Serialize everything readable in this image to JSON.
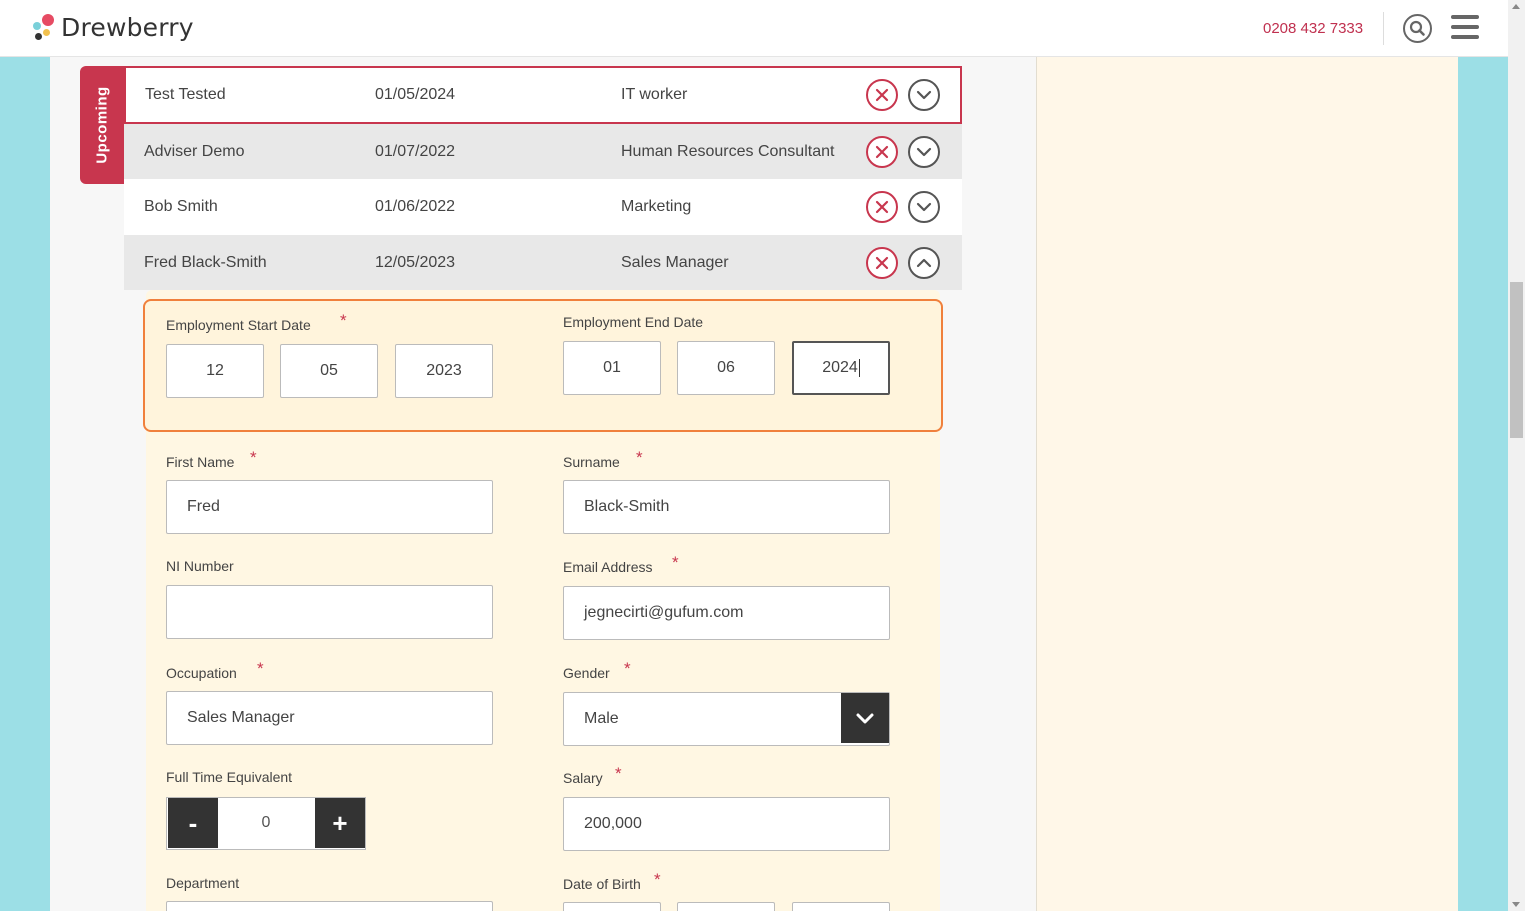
{
  "header": {
    "brand": "Drewberry",
    "phone": "0208 432 7333"
  },
  "upcoming_tab": "Upcoming",
  "employees": [
    {
      "name": "Test Tested",
      "date": "01/05/2024",
      "role": "IT worker"
    },
    {
      "name": "Adviser Demo",
      "date": "01/07/2022",
      "role": "Human Resources Consultant"
    },
    {
      "name": "Bob Smith",
      "date": "01/06/2022",
      "role": "Marketing"
    },
    {
      "name": "Fred Black-Smith",
      "date": "12/05/2023",
      "role": "Sales Manager"
    }
  ],
  "form": {
    "start_date": {
      "label": "Employment Start Date",
      "day": "12",
      "month": "05",
      "year": "2023"
    },
    "end_date": {
      "label": "Employment End Date",
      "day": "01",
      "month": "06",
      "year": "2024"
    },
    "first_name": {
      "label": "First Name",
      "value": "Fred"
    },
    "surname": {
      "label": "Surname",
      "value": "Black-Smith"
    },
    "ni_number": {
      "label": "NI Number",
      "value": ""
    },
    "email": {
      "label": "Email Address",
      "value": "jegnecirti@gufum.com"
    },
    "occupation": {
      "label": "Occupation",
      "value": "Sales Manager"
    },
    "gender": {
      "label": "Gender",
      "value": "Male"
    },
    "fte": {
      "label": "Full Time Equivalent",
      "value": "0",
      "minus": "-",
      "plus": "+"
    },
    "salary": {
      "label": "Salary",
      "value": "200,000"
    },
    "department": {
      "label": "Department"
    },
    "dob": {
      "label": "Date of Birth"
    },
    "required_mark": "*"
  },
  "colors": {
    "accent": "#c8364e",
    "highlight": "#f0803c",
    "panel": "#fff7e3"
  }
}
